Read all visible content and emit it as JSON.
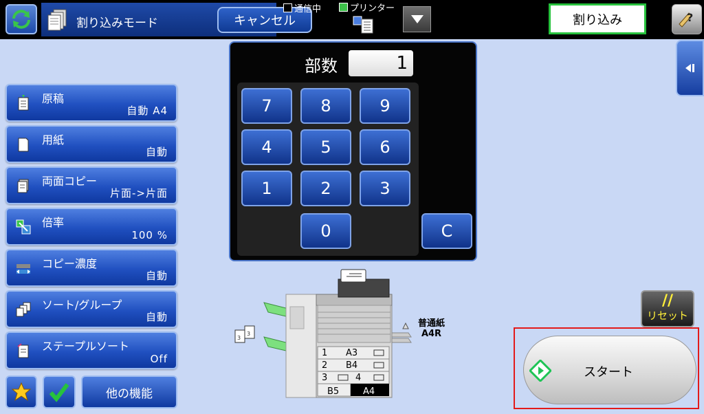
{
  "header": {
    "mode_label": "割り込みモード",
    "cancel_label": "キャンセル",
    "comm_status": "通信中",
    "printer_status": "プリンター",
    "interrupt_label": "割り込み"
  },
  "sidebar": {
    "items": [
      {
        "title": "原稿",
        "value": "自動 A4"
      },
      {
        "title": "用紙",
        "value": "自動"
      },
      {
        "title": "両面コピー",
        "value": "片面->片面"
      },
      {
        "title": "倍率",
        "value": "100 %"
      },
      {
        "title": "コピー濃度",
        "value": "自動"
      },
      {
        "title": "ソート/グループ",
        "value": "自動"
      },
      {
        "title": "ステープルソート",
        "value": "Off"
      }
    ],
    "other_functions_label": "他の機能"
  },
  "keypad": {
    "copies_label": "部数",
    "copies_value": "1",
    "keys": [
      "7",
      "8",
      "9",
      "4",
      "5",
      "6",
      "1",
      "2",
      "3",
      "0"
    ],
    "clear_label": "C"
  },
  "machine": {
    "paper_type": "普通紙",
    "paper_size": "A4R",
    "trays": [
      {
        "num": "1",
        "size": "A3"
      },
      {
        "num": "2",
        "size": "B4"
      },
      {
        "num": "3",
        "size": "4"
      },
      {
        "num": "",
        "size": "B5"
      },
      {
        "num": "",
        "size": "A4"
      }
    ]
  },
  "actions": {
    "reset_label": "リセット",
    "reset_glyph": "//",
    "start_label": "スタート"
  },
  "colors": {
    "background": "#c9d8f5",
    "button_blue": "#2050c0",
    "interrupt_border": "#27c23d",
    "highlight_red": "#e31919",
    "reset_text": "#ffef3a"
  }
}
